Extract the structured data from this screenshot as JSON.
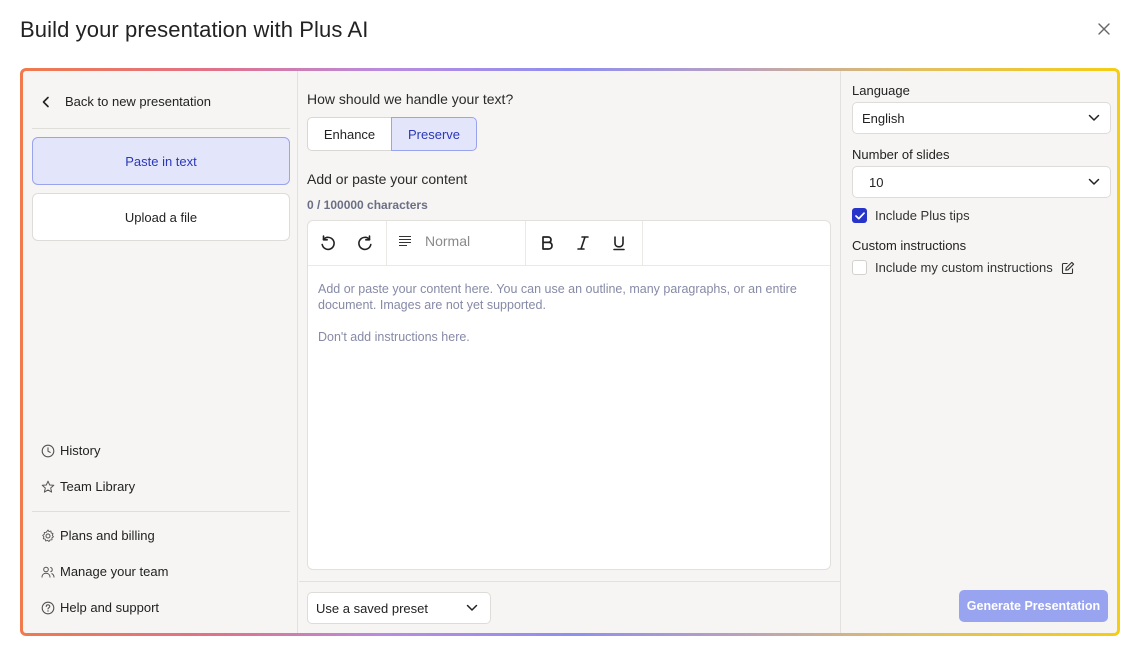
{
  "dialog": {
    "title": "Build your presentation with Plus AI"
  },
  "sidebar": {
    "back_label": "Back to new presentation",
    "modes": [
      {
        "label": "Paste in text",
        "active": true
      },
      {
        "label": "Upload a file",
        "active": false
      }
    ],
    "nav": [
      {
        "label": "History",
        "icon": "clock-icon"
      },
      {
        "label": "Team Library",
        "icon": "star-icon"
      },
      {
        "label": "Plans and billing",
        "icon": "gear-icon"
      },
      {
        "label": "Manage your team",
        "icon": "users-icon"
      },
      {
        "label": "Help and support",
        "icon": "help-circle-icon"
      }
    ]
  },
  "main": {
    "question": "How should we handle your text?",
    "text_modes": [
      {
        "label": "Enhance",
        "selected": false
      },
      {
        "label": "Preserve",
        "selected": true
      }
    ],
    "content_label": "Add or paste your content",
    "char_count": "0 / 100000 characters",
    "editor": {
      "style_label": "Normal",
      "placeholder_1": "Add or paste your content here. You can use an outline, many paragraphs, or an entire document. Images are not yet supported.",
      "placeholder_2": "Don't add instructions here."
    },
    "preset_label": "Use a saved preset"
  },
  "settings": {
    "language_label": "Language",
    "language_value": "English",
    "slides_label": "Number of slides",
    "slides_value": "10",
    "plus_tips_label": "Include Plus tips",
    "plus_tips_checked": true,
    "custom_label": "Custom instructions",
    "custom_checkbox_label": "Include my custom instructions",
    "custom_checked": false
  },
  "actions": {
    "generate_label": "Generate Presentation"
  },
  "colors": {
    "accent": "#2734c9",
    "active_bg": "#e3e6fb",
    "generate_bg": "#99a4f1"
  }
}
